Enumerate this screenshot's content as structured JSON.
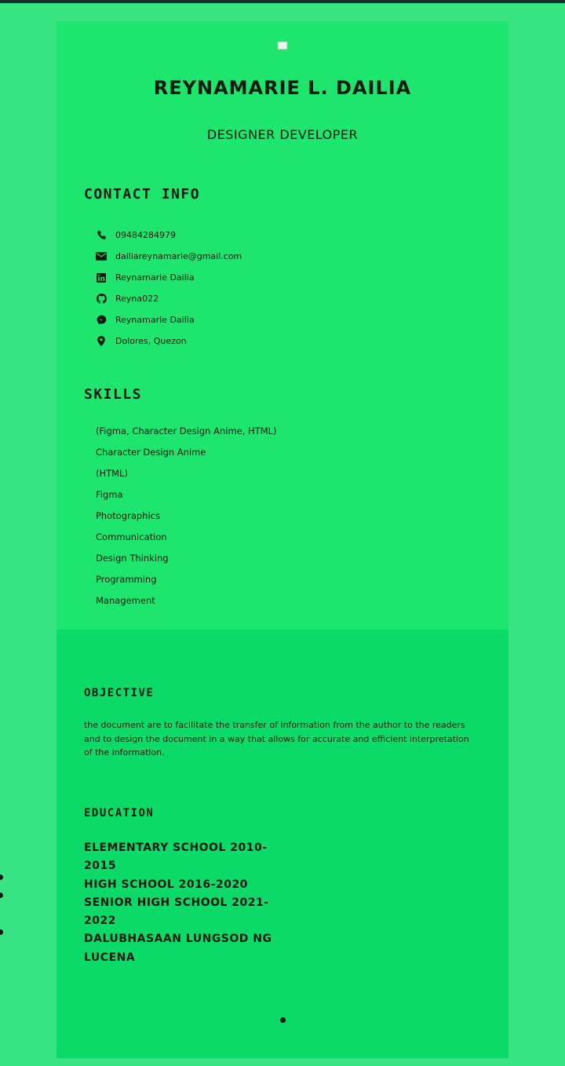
{
  "header": {
    "name": "REYNAMARIE L. DAILIA",
    "role": "DESIGNER DEVELOPER"
  },
  "contact": {
    "title": "CONTACT INFO",
    "items": [
      {
        "icon": "phone-icon",
        "text": "09484284979"
      },
      {
        "icon": "envelope-icon",
        "text": "dailiareynamarie@gmail.com"
      },
      {
        "icon": "linkedin-icon",
        "text": "Reynamarie Dailia"
      },
      {
        "icon": "github-icon",
        "text": "Reyna022"
      },
      {
        "icon": "messenger-icon",
        "text": "Reynamarie Dailia"
      },
      {
        "icon": "location-pin-icon",
        "text": "Dolores, Quezon"
      }
    ]
  },
  "skills": {
    "title": "SKILLS",
    "items": [
      "(Figma, Character Design Anime, HTML)",
      "Character Design Anime",
      "(HTML)",
      "Figma",
      "Photographics",
      "Communication",
      "Design Thinking",
      "Programming",
      "Management"
    ]
  },
  "objective": {
    "title": "OBJECTIVE",
    "text": "the document are to facilitate the transfer of information from the author to the readers and to design the document in a way that allows for accurate and efficient interpretation of the information."
  },
  "education": {
    "title": "EDUCATION",
    "items": [
      "ELEMENTARY SCHOOL 2010-2015",
      "HIGH SCHOOL 2016-2020",
      "SENIOR HIGH SCHOOL 2021-2022",
      "DALUBHASAAN LUNGSOD NG LUCENA"
    ]
  },
  "colors": {
    "page_background": "#3ae383",
    "card_top_background": "#1de56d",
    "card_bottom_background": "#0cda68",
    "text": "#0e1a12"
  }
}
